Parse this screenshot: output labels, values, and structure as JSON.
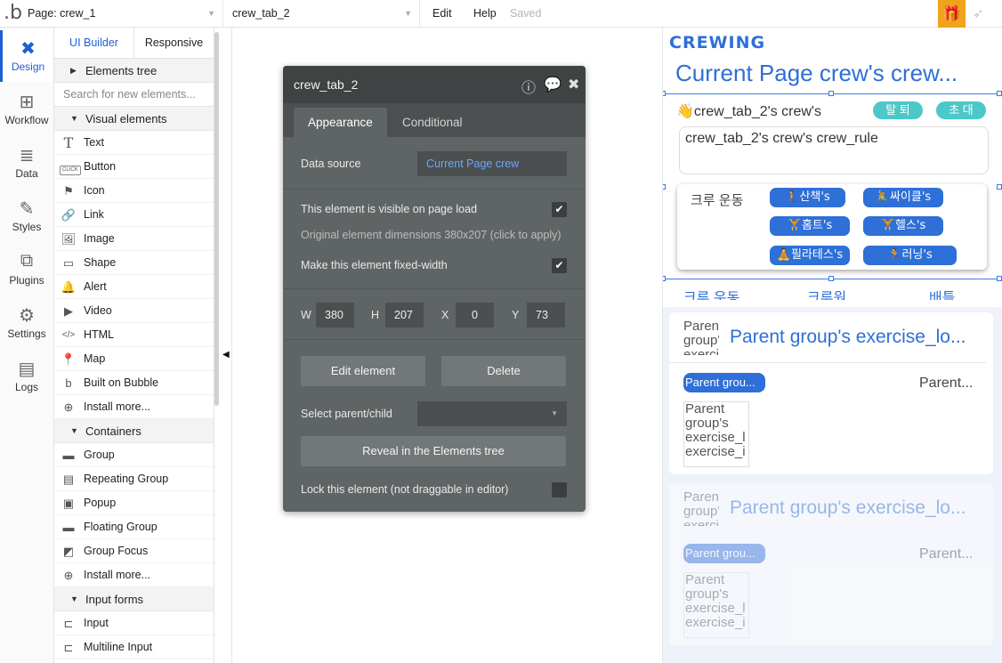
{
  "topbar": {
    "page_label": "Page: crew_1",
    "element_label": "crew_tab_2",
    "menu_edit": "Edit",
    "menu_help": "Help",
    "saved": "Saved"
  },
  "leftnav": {
    "items": [
      {
        "label": "Design",
        "icon": "design-icon"
      },
      {
        "label": "Workflow",
        "icon": "workflow-icon"
      },
      {
        "label": "Data",
        "icon": "database-icon"
      },
      {
        "label": "Styles",
        "icon": "brush-icon"
      },
      {
        "label": "Plugins",
        "icon": "plugin-icon"
      },
      {
        "label": "Settings",
        "icon": "gear-icon"
      },
      {
        "label": "Logs",
        "icon": "document-icon"
      }
    ]
  },
  "palette": {
    "tab_ui": "UI Builder",
    "tab_responsive": "Responsive",
    "elements_tree": "Elements tree",
    "search_placeholder": "Search for new elements...",
    "visual_section": "Visual elements",
    "visual_items": [
      "Text",
      "Button",
      "Icon",
      "Link",
      "Image",
      "Shape",
      "Alert",
      "Video",
      "HTML",
      "Map",
      "Built on Bubble",
      "Install more..."
    ],
    "button_tag": "CLICK",
    "containers_section": "Containers",
    "container_items": [
      "Group",
      "Repeating Group",
      "Popup",
      "Floating Group",
      "Group Focus",
      "Install more..."
    ],
    "input_section": "Input forms",
    "input_items": [
      "Input",
      "Multiline Input"
    ]
  },
  "prop": {
    "title": "crew_tab_2",
    "tab_appearance": "Appearance",
    "tab_conditional": "Conditional",
    "data_source_label": "Data source",
    "data_source_value": "Current Page crew",
    "visible_label": "This element is visible on page load",
    "original_dims": "Original element dimensions 380x207 (click to apply)",
    "fixed_width_label": "Make this element fixed-width",
    "w_label": "W",
    "w_value": "380",
    "h_label": "H",
    "h_value": "207",
    "x_label": "X",
    "x_value": "0",
    "y_label": "Y",
    "y_value": "73",
    "edit_btn": "Edit element",
    "delete_btn": "Delete",
    "select_parent_label": "Select parent/child",
    "reveal_btn": "Reveal in the Elements tree",
    "lock_label": "Lock this element (not draggable in editor)"
  },
  "preview": {
    "brand": "CREWING",
    "title": "Current Page crew's crew...",
    "crew_name": "👋crew_tab_2's crew's",
    "btn_leave": "탈 퇴",
    "btn_invite": "초 대",
    "rule": "crew_tab_2's crew's crew_rule",
    "exercise_label": "크루 운동",
    "exercises": [
      "🚶산책's",
      "🚴싸이클's",
      "🏋홈트's",
      "🏋헬스's",
      "🧘필라테스's",
      "🏃러닝's"
    ],
    "tabs": [
      "크루 운동",
      "크루원",
      "배틀"
    ],
    "card_thumb": "Parent group's exercise_lo",
    "card_title": "Parent group's exercise_lo...",
    "card_pill": "Parent grou...",
    "card_right": "Parent...",
    "card_img": "Parent group's exercise_l exercise_i"
  }
}
